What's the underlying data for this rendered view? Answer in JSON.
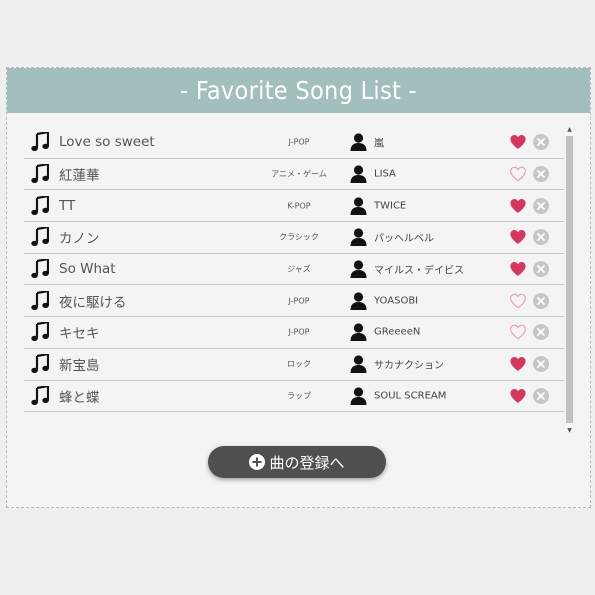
{
  "header": {
    "title": "- Favorite Song List -"
  },
  "songs": [
    {
      "title": "Love so sweet",
      "genre": "J-POP",
      "artist": "嵐",
      "favorite": true
    },
    {
      "title": "紅蓮華",
      "genre": "アニメ・ゲーム",
      "artist": "LISA",
      "favorite": false
    },
    {
      "title": "TT",
      "genre": "K-POP",
      "artist": "TWICE",
      "favorite": true
    },
    {
      "title": "カノン",
      "genre": "クラシック",
      "artist": "パッヘルベル",
      "favorite": true
    },
    {
      "title": "So What",
      "genre": "ジャズ",
      "artist": "マイルス・デイビス",
      "favorite": true
    },
    {
      "title": "夜に駆ける",
      "genre": "J-POP",
      "artist": "YOASOBI",
      "favorite": false
    },
    {
      "title": "キセキ",
      "genre": "J-POP",
      "artist": "GReeeeN",
      "favorite": false
    },
    {
      "title": "新宝島",
      "genre": "ロック",
      "artist": "サカナクション",
      "favorite": true
    },
    {
      "title": "蜂と蝶",
      "genre": "ラップ",
      "artist": "SOUL SCREAM",
      "favorite": true
    }
  ],
  "register_button": {
    "label": "曲の登録へ"
  },
  "colors": {
    "header_bg": "#a2bfbd",
    "heart_filled": "#d6365e",
    "heart_empty": "#e9a3b6",
    "delete": "#c6c6c6",
    "button_bg": "#4f4f4f"
  },
  "icons": {
    "song": "music-note-icon",
    "artist": "person-icon",
    "favorite": "heart-icon",
    "delete": "delete-circle-x-icon",
    "add": "plus-circle-icon"
  }
}
